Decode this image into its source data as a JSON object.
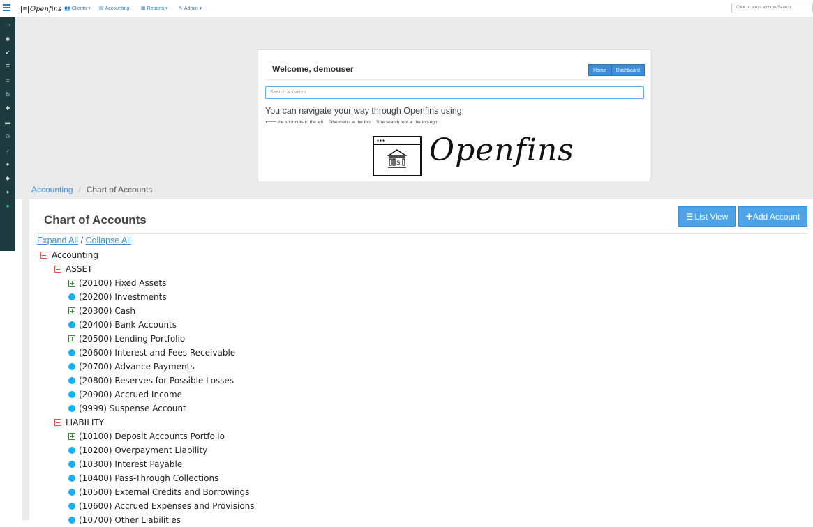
{
  "topnav": {
    "logo_text": "Openfins",
    "items": [
      {
        "icon": "users-icon",
        "label": "Clients"
      },
      {
        "icon": "book-icon",
        "label": "Accounting"
      },
      {
        "icon": "chart-icon",
        "label": "Reports"
      },
      {
        "icon": "wrench-icon",
        "label": "Admin"
      }
    ],
    "search_placeholder": "Click or press alt+x to Search"
  },
  "sidebar_icons": [
    "card-icon",
    "dashboard-icon",
    "check-icon",
    "list-icon",
    "list-alt-icon",
    "refresh-icon",
    "plus-icon",
    "folder-icon",
    "sitemap-icon",
    "bell-icon",
    "user-icon",
    "group-icon",
    "map-marker-icon",
    "help-icon"
  ],
  "welcome": {
    "title": "Welcome, demouser",
    "home_btn": "Home",
    "dashboard_btn": "Dashboard",
    "search_placeholder": "Search activities",
    "nav_text": "You can navigate your way through Openfins using:",
    "tip1": "the shortcuts to the left",
    "tip2": "the menu at the top",
    "tip3": "the search tool at the top-right",
    "brand": "Openfins"
  },
  "breadcrumb": {
    "link": "Accounting",
    "current": "Chart of Accounts"
  },
  "panel": {
    "title": "Chart of Accounts",
    "list_view": "List View",
    "add_account": "Add Account",
    "expand_all": "Expand All",
    "collapse_all": "Collapse All",
    "separator": "/"
  },
  "tree": [
    {
      "label": "Accounting",
      "type": "collapse",
      "level": 0
    },
    {
      "label": "ASSET",
      "type": "collapse",
      "level": 1
    },
    {
      "label": "(20100) Fixed Assets",
      "type": "expand",
      "level": 2
    },
    {
      "label": "(20200) Investments",
      "type": "leaf",
      "level": 2
    },
    {
      "label": "(20300) Cash",
      "type": "expand",
      "level": 2
    },
    {
      "label": "(20400) Bank Accounts",
      "type": "leaf",
      "level": 2
    },
    {
      "label": "(20500) Lending Portfolio",
      "type": "expand",
      "level": 2
    },
    {
      "label": "(20600) Interest and Fees Receivable",
      "type": "leaf",
      "level": 2
    },
    {
      "label": "(20700) Advance Payments",
      "type": "leaf",
      "level": 2
    },
    {
      "label": "(20800) Reserves for Possible Losses",
      "type": "leaf",
      "level": 2
    },
    {
      "label": "(20900) Accrued Income",
      "type": "leaf",
      "level": 2
    },
    {
      "label": "(9999) Suspense Account",
      "type": "leaf",
      "level": 2
    },
    {
      "label": "LIABILITY",
      "type": "collapse",
      "level": 1
    },
    {
      "label": "(10100) Deposit Accounts Portfolio",
      "type": "expand",
      "level": 2
    },
    {
      "label": "(10200) Overpayment Liability",
      "type": "leaf",
      "level": 2
    },
    {
      "label": "(10300) Interest Payable",
      "type": "leaf",
      "level": 2
    },
    {
      "label": "(10400) Pass-Through Collections",
      "type": "leaf",
      "level": 2
    },
    {
      "label": "(10500) External Credits and Borrowings",
      "type": "leaf",
      "level": 2
    },
    {
      "label": "(10600) Accrued Expenses and Provisions",
      "type": "leaf",
      "level": 2
    },
    {
      "label": "(10700) Other Liabilities",
      "type": "leaf",
      "level": 2
    }
  ]
}
